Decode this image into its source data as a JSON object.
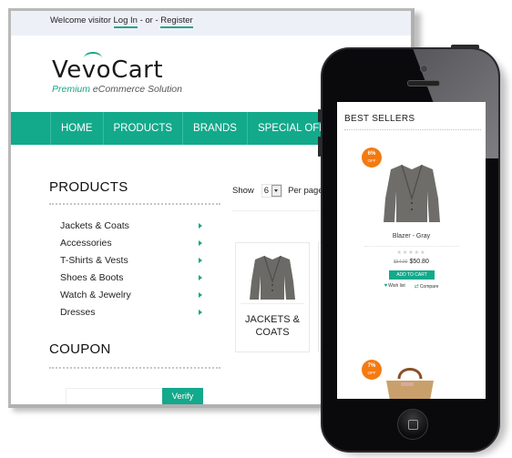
{
  "desktop": {
    "topbar": {
      "welcome": "Welcome visitor",
      "login": "Log In",
      "or": " - or - ",
      "register": "Register"
    },
    "logo": {
      "name_part1": "Ve",
      "name_swoosh": "v",
      "name_part2": "oCart",
      "tagline_accent": "Premium",
      "tagline_rest": " eCommerce Solution"
    },
    "nav": {
      "items": [
        "HOME",
        "PRODUCTS",
        "BRANDS",
        "SPECIAL OFFERS"
      ]
    },
    "sidebar": {
      "products_title": "PRODUCTS",
      "categories": [
        "Jackets & Coats",
        "Accessories",
        "T-Shirts & Vests",
        "Shoes & Boots",
        "Watch & Jewelry",
        "Dresses"
      ],
      "coupon_title": "COUPON",
      "coupon_input_value": "",
      "verify_label": "Verify"
    },
    "listing": {
      "show_label": "Show",
      "per_page_value": "6",
      "per_page_label": "Per pages",
      "category_card_label_line1": "JACKETS &",
      "category_card_label_line2": "COATS"
    }
  },
  "mobile": {
    "section_title": "BEST SELLERS",
    "products": [
      {
        "discount": "6%",
        "discount_suffix": "OFF",
        "name": "Blazer - Gray",
        "rating_stars": 0,
        "rating_max": 5,
        "old_price": "$54.00",
        "price": "$50.80",
        "add_to_cart": "ADD TO CART",
        "wishlist": "Wish list",
        "compare": "Compare"
      },
      {
        "discount": "7%",
        "discount_suffix": "OFF"
      }
    ]
  },
  "colors": {
    "accent": "#13a98b",
    "badge": "#f47a12",
    "topbar_bg": "#eef0f8"
  }
}
